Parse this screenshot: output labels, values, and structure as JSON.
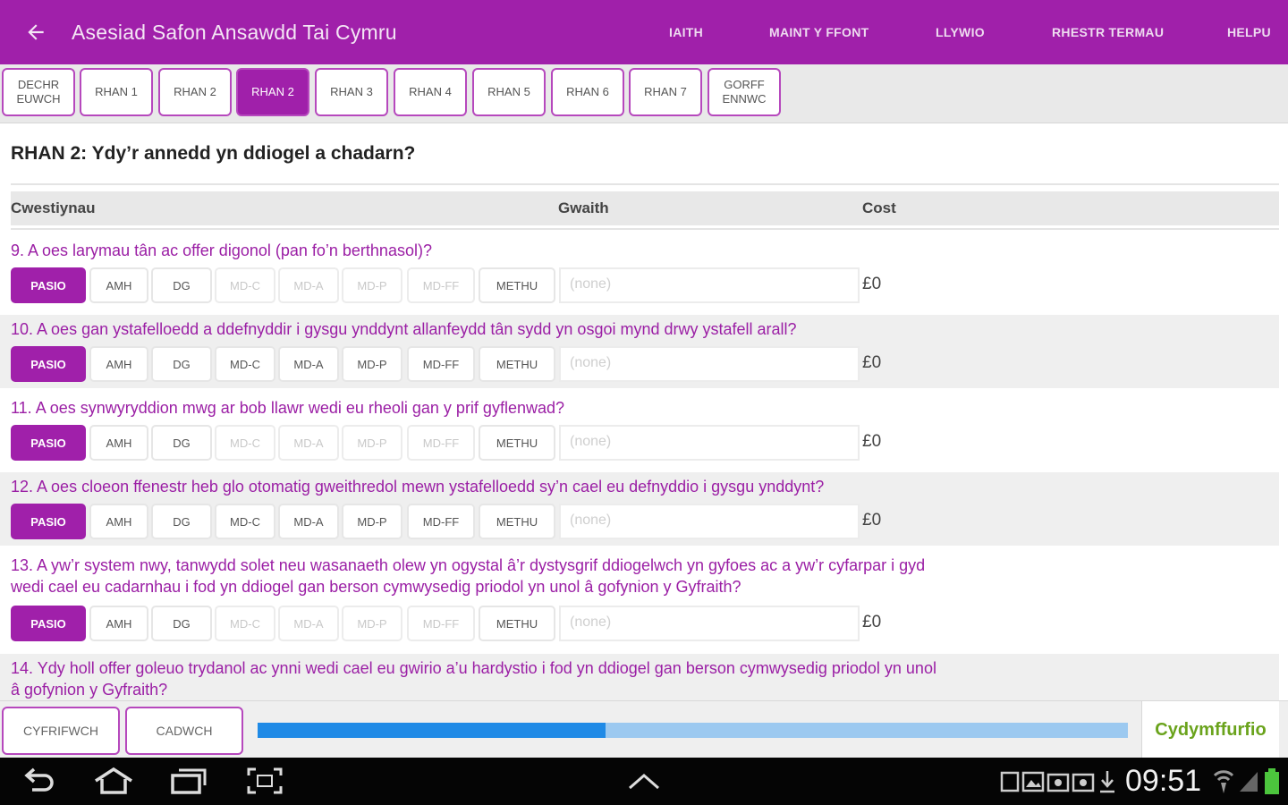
{
  "appbar": {
    "title": "Asesiad Safon Ansawdd Tai Cymru",
    "menu": [
      "IAITH",
      "MAINT Y FFONT",
      "LLYWIO",
      "RHESTR TERMAU",
      "HELPU"
    ]
  },
  "tabs": [
    {
      "label": "DECHR EUWCH"
    },
    {
      "label": "RHAN 1"
    },
    {
      "label": "RHAN 2"
    },
    {
      "label": "RHAN 2"
    },
    {
      "label": "RHAN 3"
    },
    {
      "label": "RHAN 4"
    },
    {
      "label": "RHAN 5"
    },
    {
      "label": "RHAN 6"
    },
    {
      "label": "RHAN 7"
    },
    {
      "label": "GORFF ENNWC"
    }
  ],
  "active_tab_index": 3,
  "section_heading": "RHAN 2: Ydy’r annedd yn ddiogel a chadarn?",
  "table_header": {
    "questions": "Cwestiynau",
    "work": "Gwaith",
    "cost": "Cost"
  },
  "option_labels": [
    "PASIO",
    "AMH",
    "DG",
    "MD-C",
    "MD-A",
    "MD-P",
    "MD-FF",
    "METHU"
  ],
  "questions": [
    {
      "text": "9. A oes larymau tân ac offer digonol (pan fo’n berthnasol)?",
      "selected": "PASIO",
      "disabled": [
        "MD-C",
        "MD-A",
        "MD-P",
        "MD-FF"
      ],
      "work": "(none)",
      "cost": "£0"
    },
    {
      "text": "10. A oes gan ystafelloedd a ddefnyddir i gysgu ynddynt allanfeydd tân sydd yn osgoi mynd drwy ystafell arall?",
      "selected": "PASIO",
      "disabled": [],
      "work": "(none)",
      "cost": "£0"
    },
    {
      "text": "11. A oes synwyryddion mwg ar bob llawr wedi eu rheoli gan y prif gyflenwad?",
      "selected": "PASIO",
      "disabled": [
        "MD-C",
        "MD-A",
        "MD-P",
        "MD-FF"
      ],
      "work": "(none)",
      "cost": "£0"
    },
    {
      "text": "12. A oes cloeon ffenestr heb glo otomatig gweithredol mewn ystafelloedd sy’n cael eu defnyddio i gysgu ynddynt?",
      "selected": "PASIO",
      "disabled": [],
      "work": "(none)",
      "cost": "£0"
    },
    {
      "text": "13. A yw’r system nwy, tanwydd solet neu wasanaeth olew yn ogystal â’r dystysgrif ddiogelwch yn gyfoes ac a yw’r cyfarpar i gyd wedi cael eu cadarnhau i fod yn ddiogel gan berson cymwysedig priodol yn unol â gofynion y Gyfraith?",
      "selected": "PASIO",
      "disabled": [
        "MD-C",
        "MD-A",
        "MD-P",
        "MD-FF"
      ],
      "work": "(none)",
      "cost": "£0"
    },
    {
      "text": "14. Ydy holl offer goleuo trydanol ac ynni wedi cael eu gwirio a’u hardystio i fod yn ddiogel gan berson cymwysedig priodol yn unol â gofynion y Gyfraith?"
    }
  ],
  "bottom": {
    "calculate_label": "CYFRIFWCH",
    "save_label": "CADWCH",
    "progress": 0.4,
    "compliance_label": "Cydymffurfio"
  },
  "status": {
    "time": "09:51"
  },
  "colors": {
    "accent": "#a020aa",
    "progress_fill": "#1f8ae6",
    "progress_track": "#9cc9f0",
    "compliance": "#6aa31c"
  }
}
